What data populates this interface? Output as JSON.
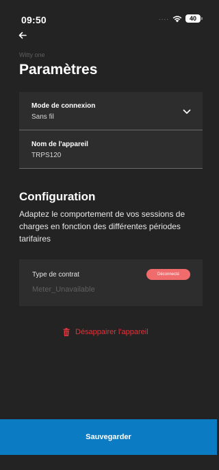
{
  "status_bar": {
    "time": "09:50",
    "signal": "....",
    "battery": "40"
  },
  "header": {
    "subtitle": "Witty one",
    "title": "Paramètres"
  },
  "connection": {
    "mode_label": "Mode de connexion",
    "mode_value": "Sans fil",
    "device_label": "Nom de l'appareil",
    "device_value": "TRPS120"
  },
  "configuration": {
    "title": "Configuration",
    "description": "Adaptez le comportement de vos sessions de charges en fonction des différentes périodes tarifaires"
  },
  "contract": {
    "label": "Type de contrat",
    "value": "Meter_Unavailable",
    "status": "Déconnecté"
  },
  "actions": {
    "delete_label": "Désappairer l'appareil",
    "save_label": "Sauvegarder"
  },
  "colors": {
    "background": "#232323",
    "card": "#2d2d2d",
    "accent_blue": "#0b7bc3",
    "danger_red": "#e0343c",
    "badge_red": "#f06b6b"
  },
  "icons": {
    "back": "arrow-left-icon",
    "wifi": "wifi-icon",
    "chevron": "chevron-down-icon",
    "delete": "trash-icon"
  }
}
